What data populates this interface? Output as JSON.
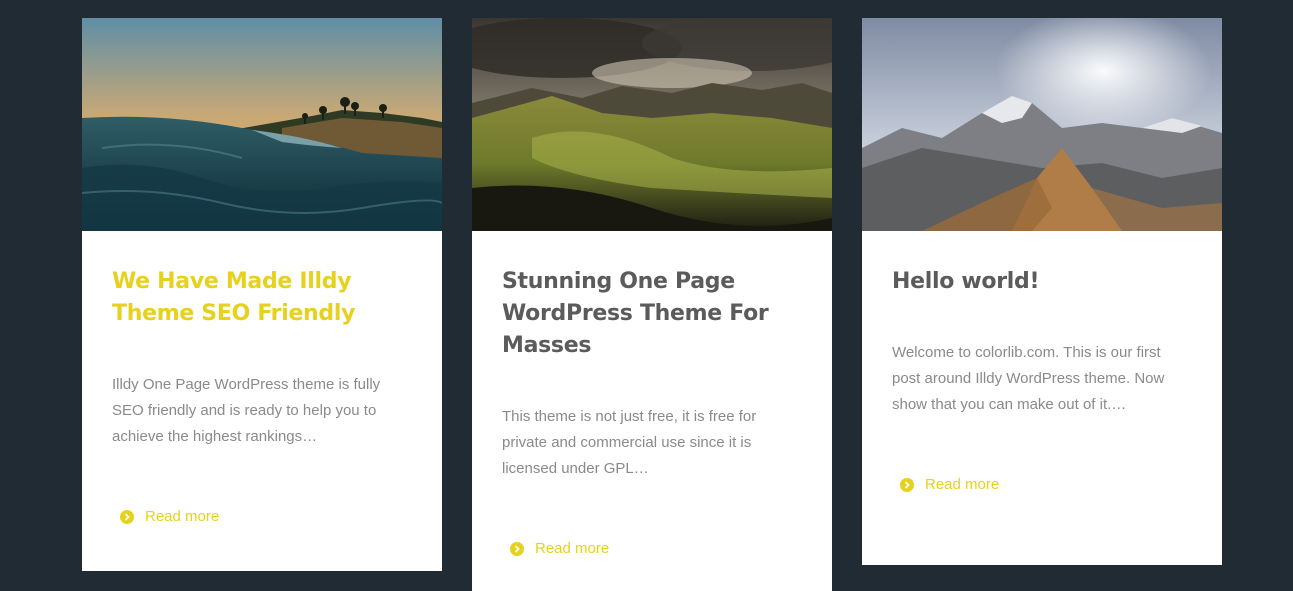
{
  "posts": [
    {
      "title": "We Have Made Illdy Theme SEO Friendly",
      "excerpt": "Illdy One Page WordPress theme is fully SEO friendly and is ready to help you to achieve the highest rankings…",
      "read_more": "Read more",
      "image": "ocean-wave-coast-photo",
      "title_color": "#e6d21e"
    },
    {
      "title": "Stunning One Page WordPress Theme For Masses",
      "excerpt": "This theme is not just free, it is free for private and commercial use since it is licensed under GPL…",
      "read_more": "Read more",
      "image": "mountain-valley-photo",
      "title_color": "#5b5b5b"
    },
    {
      "title": "Hello world!",
      "excerpt": "Welcome to colorlib.com. This is our first post around Illdy WordPress theme. Now show that you can make out of it.…",
      "read_more": "Read more",
      "image": "rocky-mountain-peak-photo",
      "title_color": "#5b5b5b"
    }
  ],
  "colors": {
    "background": "#212b33",
    "accent": "#e6d21e",
    "card": "#ffffff",
    "heading": "#5b5b5b",
    "text": "#8a8a8a"
  },
  "icons": {
    "read_more": "chevron-circle-right-icon"
  }
}
